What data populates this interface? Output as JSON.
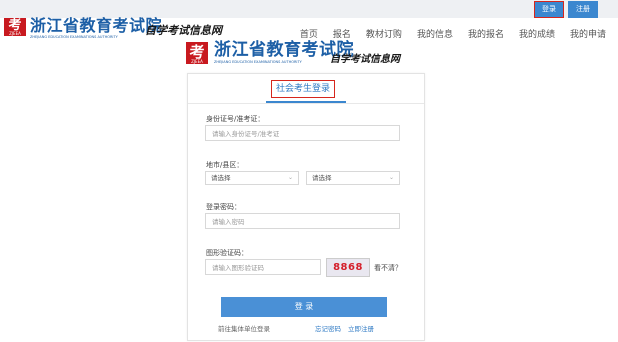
{
  "topbar": {
    "login": "登录",
    "register": "注册"
  },
  "header": {
    "logo_char": "考",
    "logo_small": "ZJEEA",
    "brand_name": "浙江省教育考试院",
    "brand_en": "ZHEJIANG EDUCATION EXAMINATIONS AUTHORITY",
    "subtitle": "自学考试信息网"
  },
  "nav": {
    "items": [
      {
        "label": "首页"
      },
      {
        "label": "报名"
      },
      {
        "label": "教材订购"
      },
      {
        "label": "我的信息"
      },
      {
        "label": "我的报名"
      },
      {
        "label": "我的成绩"
      },
      {
        "label": "我的申请"
      }
    ]
  },
  "center_logo": {
    "brand_name": "浙江省教育考试院",
    "brand_en": "ZHEJIANG EDUCATION EXAMINATIONS AUTHORITY",
    "subtitle": "自学考试信息网"
  },
  "form": {
    "tab": "社会考生登录",
    "id_label": "身份证号/准考证：",
    "id_placeholder": "请输入身份证号/准考证",
    "region_label": "地市/县区：",
    "city_value": "请选择",
    "county_value": "请选择",
    "password_label": "登录密码：",
    "password_placeholder": "请输入密码",
    "captcha_label": "图形验证码：",
    "captcha_placeholder": "请输入图形验证码",
    "captcha_text": "8868",
    "captcha_refresh": "看不清？",
    "submit": "登 录",
    "link_unit": "前往集体单位登录",
    "link_forgot": "忘记密码",
    "link_register": "立即注册"
  },
  "colors": {
    "accent": "#3b87cf",
    "brand_blue": "#1d5fa6",
    "logo_red": "#c8191f",
    "highlight_red": "#d6261c"
  }
}
